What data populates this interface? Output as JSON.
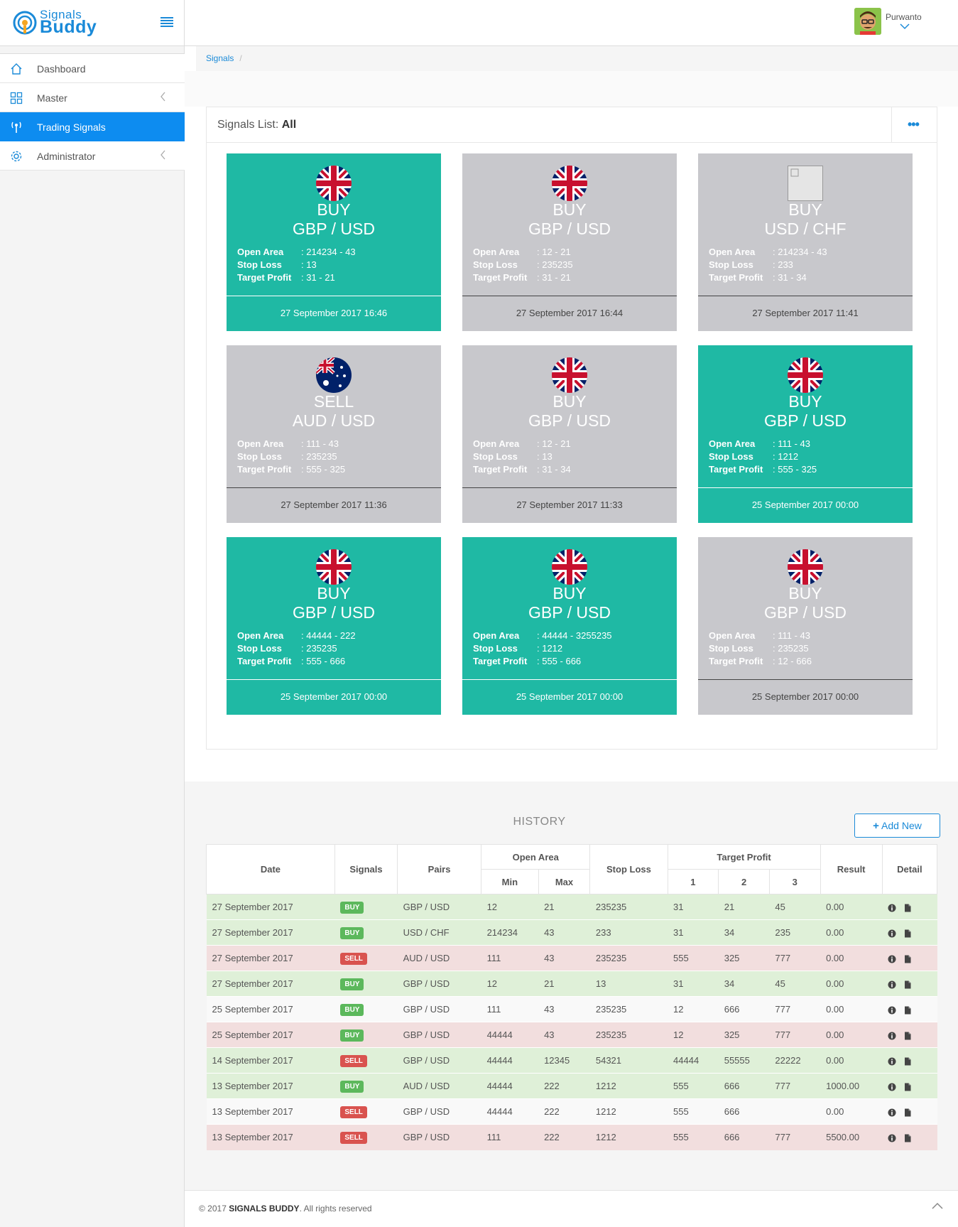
{
  "brand": {
    "line1": "Signals",
    "line2": "Buddy"
  },
  "user": {
    "name": "Purwanto"
  },
  "sidebar": {
    "items": [
      {
        "label": "Dashboard",
        "icon": "home-icon"
      },
      {
        "label": "Master",
        "icon": "grid-icon"
      },
      {
        "label": "Trading Signals",
        "icon": "antenna-icon"
      },
      {
        "label": "Administrator",
        "icon": "gear-icon"
      }
    ]
  },
  "breadcrumb": {
    "item": "Signals",
    "sep": "/"
  },
  "panel": {
    "title_prefix": "Signals List:",
    "title_filter": "All",
    "menu_glyph": "•••"
  },
  "labels": {
    "open_area": "Open Area",
    "stop_loss": "Stop Loss",
    "target_profit": "Target Profit"
  },
  "cards": [
    {
      "dir": "BUY",
      "pair": "GBP / USD",
      "open": ": 214234 - 43",
      "stop": ": 13",
      "target": ": 31 - 21",
      "date": "27 September 2017 16:46",
      "color": "#1fb9a4",
      "flag": "uk"
    },
    {
      "dir": "BUY",
      "pair": "GBP / USD",
      "open": ": 12 - 21",
      "stop": ": 235235",
      "target": ": 31 - 21",
      "date": "27 September 2017 16:44",
      "color": "#c8c8cc",
      "flag": "uk"
    },
    {
      "dir": "BUY",
      "pair": "USD / CHF",
      "open": ": 214234 - 43",
      "stop": ": 233",
      "target": ": 31 - 34",
      "date": "27 September 2017 11:41",
      "color": "#c8c8cc",
      "flag": "broken"
    },
    {
      "dir": "SELL",
      "pair": "AUD / USD",
      "open": ": 111 - 43",
      "stop": ": 235235",
      "target": ": 555 - 325",
      "date": "27 September 2017 11:36",
      "color": "#c8c8cc",
      "flag": "au"
    },
    {
      "dir": "BUY",
      "pair": "GBP / USD",
      "open": ": 12 - 21",
      "stop": ": 13",
      "target": ": 31 - 34",
      "date": "27 September 2017 11:33",
      "color": "#c8c8cc",
      "flag": "uk"
    },
    {
      "dir": "BUY",
      "pair": "GBP / USD",
      "open": ": 111 - 43",
      "stop": ": 1212",
      "target": ": 555 - 325",
      "date": "25 September 2017 00:00",
      "color": "#1fb9a4",
      "flag": "uk"
    },
    {
      "dir": "BUY",
      "pair": "GBP / USD",
      "open": ": 44444 - 222",
      "stop": ": 235235",
      "target": ": 555 - 666",
      "date": "25 September 2017 00:00",
      "color": "#1fb9a4",
      "flag": "uk"
    },
    {
      "dir": "BUY",
      "pair": "GBP / USD",
      "open": ": 44444 - 3255235",
      "stop": ": 1212",
      "target": ": 555 - 666",
      "date": "25 September 2017 00:00",
      "color": "#1fb9a4",
      "flag": "uk"
    },
    {
      "dir": "BUY",
      "pair": "GBP / USD",
      "open": ": 111 - 43",
      "stop": ": 235235",
      "target": ": 12 - 666",
      "date": "25 September 2017 00:00",
      "color": "#c8c8cc",
      "flag": "uk"
    }
  ],
  "history": {
    "title": "HISTORY",
    "add_label": "Add New",
    "add_glyph": "+",
    "headers": {
      "date": "Date",
      "signals": "Signals",
      "pairs": "Pairs",
      "open_area": "Open Area",
      "min": "Min",
      "max": "Max",
      "stop_loss": "Stop Loss",
      "target_profit": "Target Profit",
      "t1": "1",
      "t2": "2",
      "t3": "3",
      "result": "Result",
      "detail": "Detail"
    },
    "rows": [
      {
        "date": "27 September 2017",
        "signal": "BUY",
        "pair": "GBP / USD",
        "min": "12",
        "max": "21",
        "stop": "235235",
        "t1": "31",
        "t2": "21",
        "t3": "45",
        "result": "0.00",
        "bg": "g"
      },
      {
        "date": "27 September 2017",
        "signal": "BUY",
        "pair": "USD / CHF",
        "min": "214234",
        "max": "43",
        "stop": "233",
        "t1": "31",
        "t2": "34",
        "t3": "235",
        "result": "0.00",
        "bg": "g"
      },
      {
        "date": "27 September 2017",
        "signal": "SELL",
        "pair": "AUD / USD",
        "min": "111",
        "max": "43",
        "stop": "235235",
        "t1": "555",
        "t2": "325",
        "t3": "777",
        "result": "0.00",
        "bg": "r"
      },
      {
        "date": "27 September 2017",
        "signal": "BUY",
        "pair": "GBP / USD",
        "min": "12",
        "max": "21",
        "stop": "13",
        "t1": "31",
        "t2": "34",
        "t3": "45",
        "result": "0.00",
        "bg": "g"
      },
      {
        "date": "25 September 2017",
        "signal": "BUY",
        "pair": "GBP / USD",
        "min": "111",
        "max": "43",
        "stop": "235235",
        "t1": "12",
        "t2": "666",
        "t3": "777",
        "result": "0.00",
        "bg": "w"
      },
      {
        "date": "25 September 2017",
        "signal": "BUY",
        "pair": "GBP / USD",
        "min": "44444",
        "max": "43",
        "stop": "235235",
        "t1": "12",
        "t2": "325",
        "t3": "777",
        "result": "0.00",
        "bg": "r"
      },
      {
        "date": "14 September 2017",
        "signal": "SELL",
        "pair": "GBP / USD",
        "min": "44444",
        "max": "12345",
        "stop": "54321",
        "t1": "44444",
        "t2": "55555",
        "t3": "22222",
        "result": "0.00",
        "bg": "g"
      },
      {
        "date": "13 September 2017",
        "signal": "BUY",
        "pair": "AUD / USD",
        "min": "44444",
        "max": "222",
        "stop": "1212",
        "t1": "555",
        "t2": "666",
        "t3": "777",
        "result": "1000.00",
        "bg": "g"
      },
      {
        "date": "13 September 2017",
        "signal": "SELL",
        "pair": "GBP / USD",
        "min": "44444",
        "max": "222",
        "stop": "1212",
        "t1": "555",
        "t2": "666",
        "t3": "",
        "result": "0.00",
        "bg": "w"
      },
      {
        "date": "13 September 2017",
        "signal": "SELL",
        "pair": "GBP / USD",
        "min": "111",
        "max": "222",
        "stop": "1212",
        "t1": "555",
        "t2": "666",
        "t3": "777",
        "result": "5500.00",
        "bg": "r"
      }
    ]
  },
  "footer": {
    "prefix": "© 2017",
    "brand": "SIGNALS BUDDY",
    "suffix": ". All rights reserved"
  }
}
